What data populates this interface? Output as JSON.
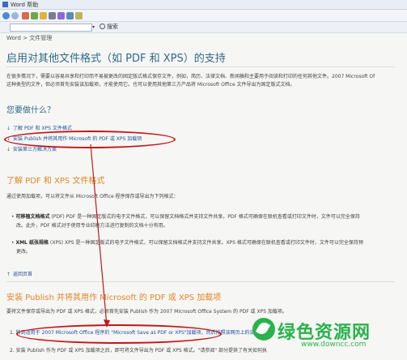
{
  "window": {
    "title": "Word 帮助"
  },
  "search": {
    "button_label": "搜索"
  },
  "breadcrumb": "Word > 文件管理",
  "page_title": "启用对其他文件格式（如 PDF 和 XPS）的支持",
  "intro": [
    "在很多情况下，需要以容易共享和打印而不易被更改的固定版式格式保存文件，例如，简历、法律文档、新闻稿和主要用于阅读和打印的任何其他文件。2007 Microsoft Of",
    "这种类型的文件，但必须首先安装该加载项，才能使用它。也可以使用其他第三方产品将 Microsoft Office 文件导出为固定版式文档。"
  ],
  "what_to_do": "您要做什么？",
  "links": [
    "了解 PDF 和 XPS 文件格式",
    "安装 Publish 并将其用作 Microsoft 的 PDF 或 XPS 加载项",
    "安装第三方解决方案"
  ],
  "section1": {
    "heading": "了解 PDF 和 XPS 文件格式",
    "desc": "通过使用加载项，可以将文件从 Microsoft Office 程序保存或导出为下列格式：",
    "bullet1_line1_bold": "可移植文档格式",
    "bullet1_line1": "(PDF)  PDF 是一种固定版式的电子文件格式，可以保留文档格式并支持文件共享。PDF 格式可确保在联机查看或打印文件时，文件可以完全保持",
    "bullet1_line2": "改。此外，PDF 格式对于使用专业印刷方法进行复制的文档十分有用。",
    "bullet2_line1_bold": "XML 纸张规格",
    "bullet2_line1": "(XPS)  XPS 是一种固定版式的电子文件格式，可以保留文档格式并支持文件共享。XPS 格式可确保在联机查看或打印文件时，文件可以完全保持预",
    "bullet2_line2": "更改。",
    "back_to_top": "返回页首"
  },
  "section2": {
    "heading": "安装 Publish 并将其用作 Microsoft 的 PDF 或 XPS 加载项",
    "desc": "要将文件保存或导出为 PDF 或 XPS 格式，必须首先安装 Publish 作为 2007 Microsoft Office System 的 PDF 或 XPS 加载项。",
    "step1_num": "1.",
    "step1": "转到适用于 2007 Microsoft Office 程序的 \"Microsoft Save as PDF or XPS\"加载项，然后按照该网页上的说明操作。",
    "step2_num": "2.",
    "step2": "安装 Publish 作为 PDF 或 XPS 加载项之后，即可将文件导出为 PDF 或 XPS 格式。\"请参阅\" 部分提供了有关如何执"
  },
  "watermark": {
    "text": "绿色资源网",
    "url": "www.downcc.com"
  },
  "colors": {
    "heading": "#2f6a8a",
    "accent_orange": "#e0862a",
    "annotation_red": "#c0171b",
    "watermark_green": "#2bb24c"
  }
}
